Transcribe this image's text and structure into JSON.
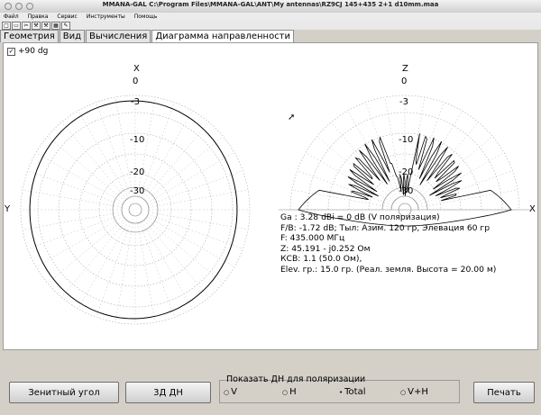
{
  "window": {
    "title": "MMANA-GAL  C:\\Program Files\\MMANA-GAL\\ANT\\My antennas\\RZ9CJ 145+435 2+1 d10mm.maa"
  },
  "menu": [
    "Файл",
    "Правка",
    "Сервис",
    "Инструменты",
    "Помощь"
  ],
  "toolbar": [
    "□",
    "▭",
    "✂",
    "⚒",
    "⚒",
    "▦",
    "✎"
  ],
  "tabs": [
    {
      "label": "Геометрия",
      "active": false
    },
    {
      "label": "Вид",
      "active": false
    },
    {
      "label": "Вычисления",
      "active": false
    },
    {
      "label": "Диаграмма направленности",
      "active": true
    }
  ],
  "plot": {
    "checkbox_label": "+90 dg",
    "checkbox_mark": "✓",
    "horizontal": {
      "top_axis": "X",
      "left_axis": "Y",
      "rings": [
        "0",
        "-3",
        "-10",
        "-20",
        "-30"
      ]
    },
    "vertical": {
      "top_axis": "Z",
      "right_axis": "X",
      "rings": [
        "0",
        "-3",
        "-10",
        "-20",
        "-30"
      ]
    }
  },
  "info": {
    "ga": "Ga : 3.28 dBi = 0 dB  (V поляризация)",
    "fb": "F/B: -1.72 dB; Тыл: Азим. 120 гр, Элевация 60 гр",
    "freq": "F: 435.000 МГц",
    "z": "Z: 45.191 - j0.252 Ом",
    "swr": "КСВ: 1.1 (50.0 Ом),",
    "elev": "Elev. гр.: 15.0 гр. (Реал. земля. Высота = 20.00 м)"
  },
  "bottom": {
    "zenith_button": "Зенитный угол",
    "d3_button": "3Д  ДН",
    "group_title": "Показать ДН для поляризации",
    "radios": [
      {
        "label": "V",
        "selected": false
      },
      {
        "label": "H",
        "selected": false
      },
      {
        "label": "Total",
        "selected": true
      },
      {
        "label": "V+H",
        "selected": false
      }
    ],
    "print_button": "Печать"
  },
  "radio_marks": {
    "selected": "•",
    "unselected": "○"
  }
}
